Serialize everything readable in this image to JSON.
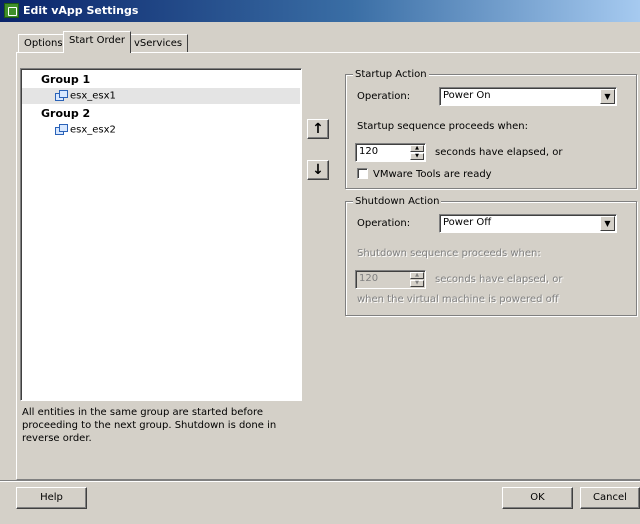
{
  "window": {
    "title": "Edit vApp Settings"
  },
  "tabs": [
    {
      "label": "Options"
    },
    {
      "label": "Start Order"
    },
    {
      "label": "vServices"
    }
  ],
  "tree": {
    "groups": [
      {
        "label": "Group 1",
        "items": [
          {
            "label": "esx_esx1",
            "selected": true
          }
        ]
      },
      {
        "label": "Group 2",
        "items": [
          {
            "label": "esx_esx2",
            "selected": false
          }
        ]
      }
    ]
  },
  "help_text": "All entities in the same group are started before proceeding to the next group. Shutdown is done in reverse order.",
  "arrows": {
    "up": "↑",
    "down": "↓"
  },
  "startup": {
    "legend": "Startup Action",
    "operation_label": "Operation:",
    "operation_value": "Power On",
    "proceeds_label": "Startup sequence proceeds when:",
    "seconds_value": "120",
    "seconds_label": "seconds have elapsed, or",
    "tools_label": "VMware Tools are ready"
  },
  "shutdown": {
    "legend": "Shutdown Action",
    "operation_label": "Operation:",
    "operation_value": "Power Off",
    "proceeds_label": "Shutdown sequence proceeds when:",
    "seconds_value": "120",
    "seconds_label": "seconds have elapsed, or",
    "powered_off_label": "when the virtual machine is powered off"
  },
  "buttons": {
    "help": "Help",
    "ok": "OK",
    "cancel": "Cancel"
  },
  "colors": {
    "titlebar": "#0a246a",
    "face": "#d4d0c8",
    "selection": "#e4e4e4"
  }
}
